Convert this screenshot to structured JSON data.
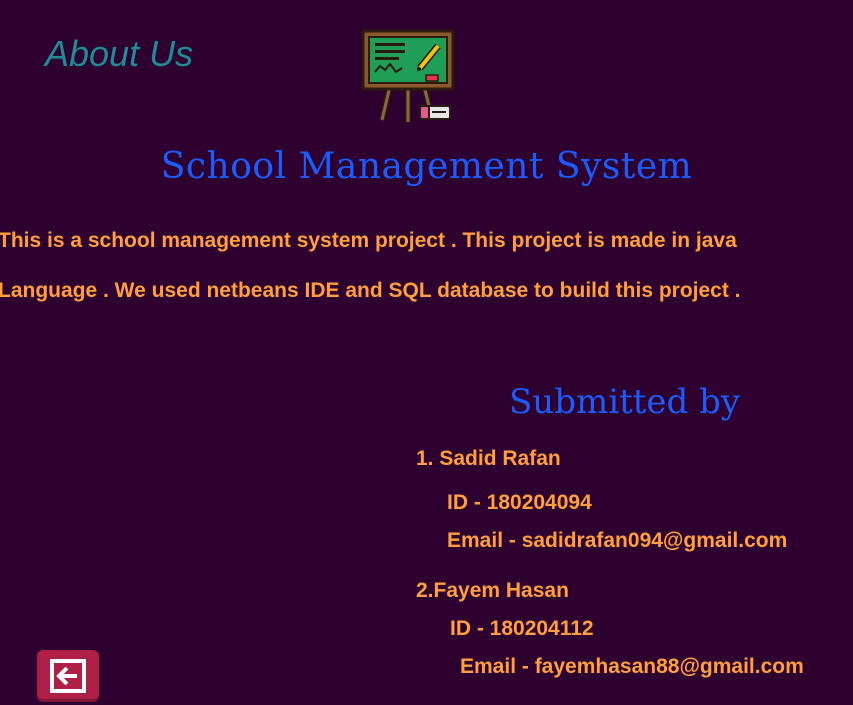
{
  "page": {
    "heading": "About Us",
    "title": "School Management System",
    "description": [
      "This is a school management system project . This project is made in java",
      "Language . We used netbeans IDE and SQL database to build this project ."
    ]
  },
  "submitted": {
    "heading": "Submitted by",
    "members": [
      {
        "name": "1. Sadid Rafan",
        "id": "ID - 180204094",
        "email": "Email - sadidrafan094@gmail.com"
      },
      {
        "name": "2.Fayem Hasan",
        "id": "ID - 180204112",
        "email": "Email - fayemhasan88@gmail.com"
      }
    ]
  },
  "icons": {
    "header_icon": "chalkboard-easel-icon",
    "back_button_icon": "back-arrow-icon"
  },
  "colors": {
    "background": "#2d0030",
    "heading": "#1f8c96",
    "title": "#1a5cff",
    "text": "#ff9f3d",
    "back_button": "#b01f45"
  }
}
